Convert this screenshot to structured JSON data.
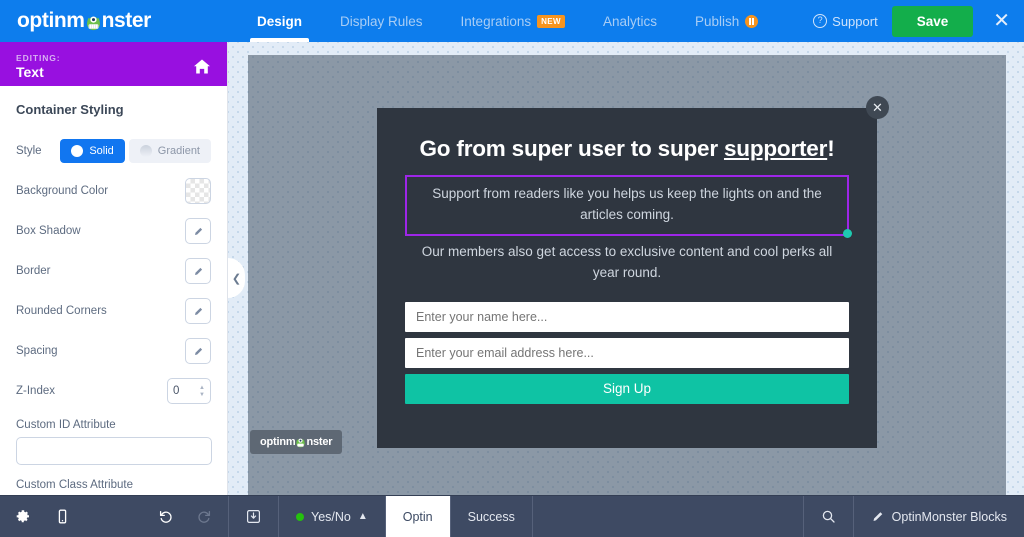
{
  "header": {
    "brand": "optinm",
    "brand_suffix": "nster",
    "brand_icon": "monster-logo-icon",
    "tabs": [
      {
        "label": "Design",
        "active": true,
        "badge": null
      },
      {
        "label": "Display Rules",
        "active": false,
        "badge": null
      },
      {
        "label": "Integrations",
        "active": false,
        "badge": "NEW"
      },
      {
        "label": "Analytics",
        "active": false,
        "badge": null
      },
      {
        "label": "Publish",
        "active": false,
        "badge": "pause-dot"
      }
    ],
    "support_label": "Support",
    "support_icon": "question-circle-icon",
    "save_label": "Save",
    "close_icon": "close-icon",
    "accent_blue": "#0d7ded",
    "save_green": "#13ae4b"
  },
  "sidebar": {
    "editing_label": "EDITING:",
    "editing_value": "Text",
    "home_icon": "home-icon",
    "purple": "#9810e0",
    "panel_title": "Container Styling",
    "rows": [
      {
        "label": "Style",
        "control": "segmented"
      },
      {
        "label": "Background Color",
        "control": "swatch"
      },
      {
        "label": "Box Shadow",
        "control": "pencil"
      },
      {
        "label": "Border",
        "control": "pencil"
      },
      {
        "label": "Rounded Corners",
        "control": "pencil"
      },
      {
        "label": "Spacing",
        "control": "pencil"
      },
      {
        "label": "Z-Index",
        "control": "stepper"
      }
    ],
    "style_options": [
      {
        "label": "Solid",
        "selected": true
      },
      {
        "label": "Gradient",
        "selected": false
      }
    ],
    "zindex_value": "0",
    "custom_id_label": "Custom ID Attribute",
    "custom_id_value": "",
    "custom_id_placeholder": "",
    "custom_class_label": "Custom Class Attribute",
    "custom_class_value": "",
    "custom_class_placeholder": "",
    "collapse_icon": "chevron-left-icon"
  },
  "popup": {
    "close_icon": "close-icon",
    "heading_a": "Go from super user to super ",
    "heading_underlined": "supporter",
    "heading_b": "!",
    "selected_paragraph": "Support from readers like you helps us keep the lights on and the articles coming.",
    "paragraph_2": "Our members also get access to exclusive content and cool perks all year round.",
    "name_placeholder": "Enter your name here...",
    "email_placeholder": "Enter your email address here...",
    "submit_label": "Sign Up",
    "selection_color": "#9e26e8",
    "handle_color": "#1ecab0",
    "submit_color": "#0fc3a4",
    "background": "#2f3640"
  },
  "canvas": {
    "badge_text": "optinm",
    "badge_suffix": "nster",
    "badge_icon": "monster-logo-icon"
  },
  "bottombar": {
    "settings_icon": "gear-icon",
    "mobile_icon": "mobile-icon",
    "undo_icon": "undo-icon",
    "redo_icon": "redo-icon",
    "save_template_icon": "save-template-icon",
    "yesno_label": "Yes/No",
    "yesno_chevron": "chevron-up-icon",
    "tabs": [
      {
        "label": "Optin",
        "active": true
      },
      {
        "label": "Success",
        "active": false
      }
    ],
    "search_icon": "search-icon",
    "blocks_icon": "pencil-icon",
    "blocks_label": "OptinMonster Blocks"
  }
}
